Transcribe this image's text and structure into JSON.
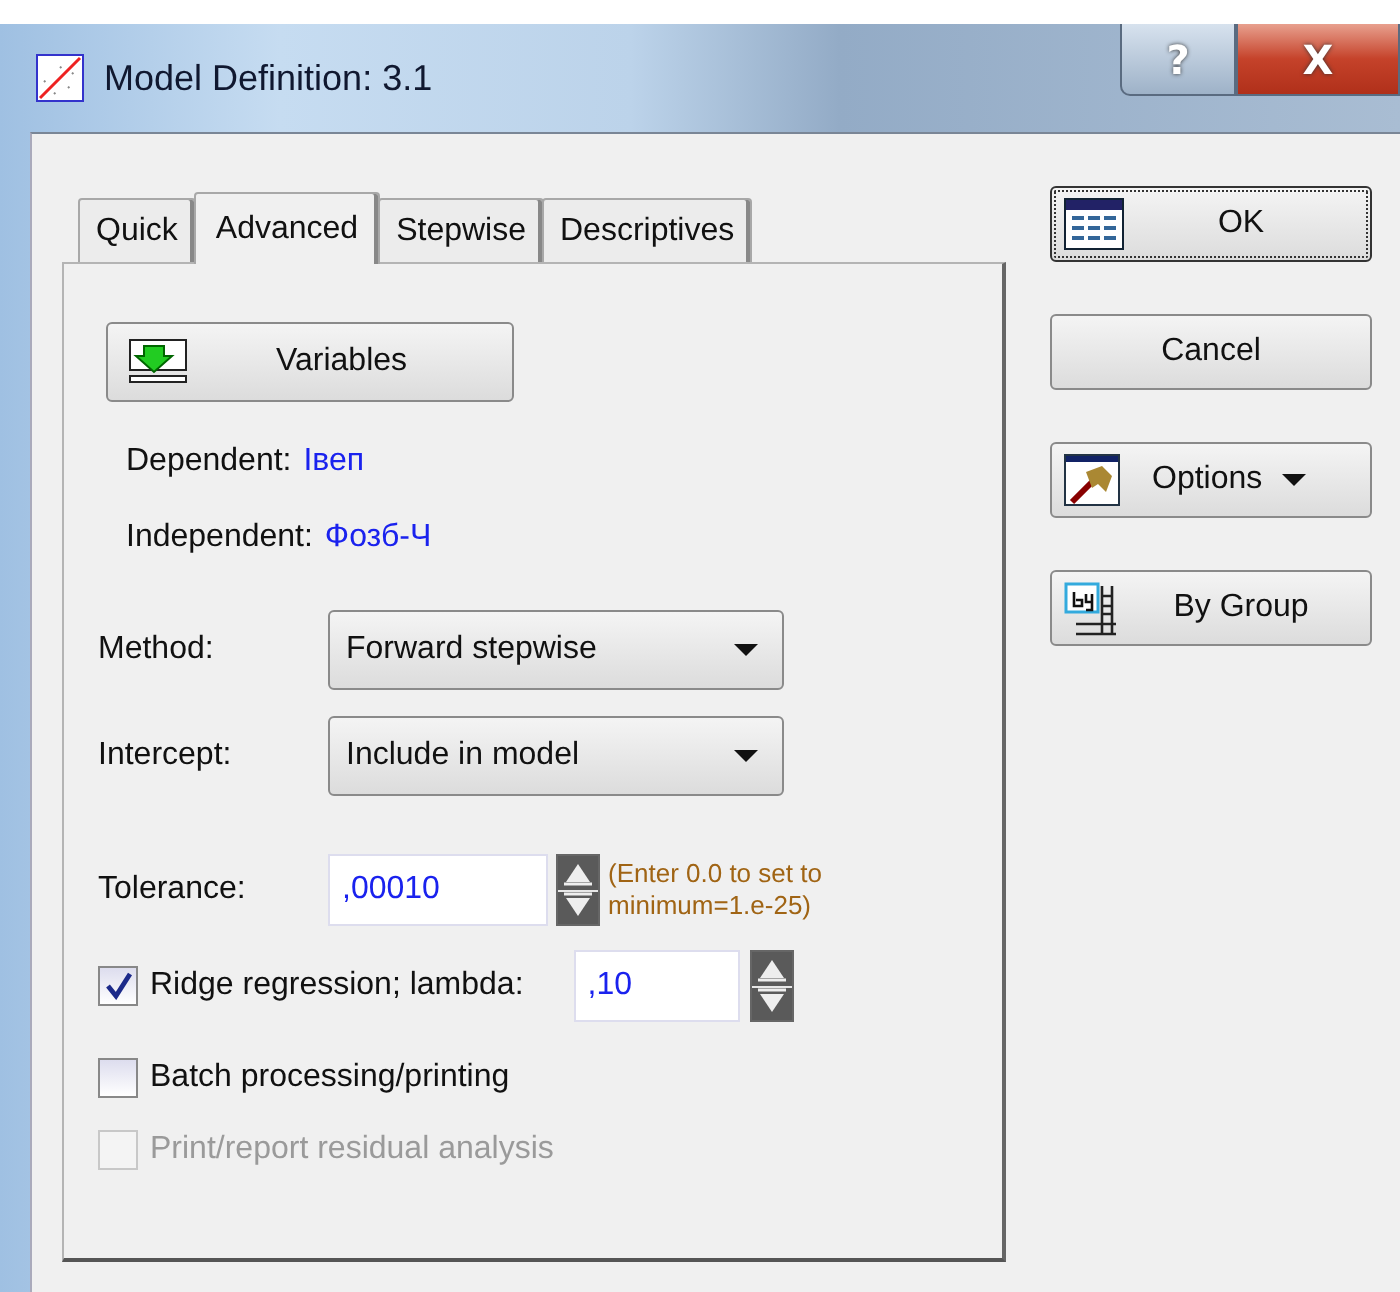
{
  "window": {
    "title": "Model Definition: 3.1",
    "help_label": "?",
    "close_label": "X"
  },
  "tabs": [
    {
      "label": "Quick",
      "selected": false
    },
    {
      "label": "Advanced",
      "selected": true
    },
    {
      "label": "Stepwise",
      "selected": false
    },
    {
      "label": "Descriptives",
      "selected": false
    }
  ],
  "variables_button": {
    "label": "Variables"
  },
  "variables": [
    {
      "label": "Dependent:",
      "value": "Івеп"
    },
    {
      "label": "Independent:",
      "value": "Фозб-Ч"
    }
  ],
  "dropdowns": [
    {
      "label": "Method:",
      "value": "Forward stepwise"
    },
    {
      "label": "Intercept:",
      "value": "Include in model"
    }
  ],
  "tolerance": {
    "label": "Tolerance:",
    "value": ",00010",
    "note": "(Enter 0.0 to set to minimum=1.e-25)"
  },
  "checks": [
    {
      "kind": "with-field",
      "label": "Ridge regression; lambda:",
      "checked": true,
      "disabled": false,
      "value": ",10"
    },
    {
      "kind": "plain",
      "label": "Batch processing/printing",
      "checked": false,
      "disabled": false
    },
    {
      "kind": "plain",
      "label": "Print/report residual analysis",
      "checked": false,
      "disabled": true
    }
  ],
  "side_buttons": [
    {
      "kind": "default",
      "label": "OK"
    },
    {
      "kind": "plain",
      "label": "Cancel"
    },
    {
      "kind": "menu",
      "label": "Options"
    },
    {
      "kind": "group",
      "label": "By Group"
    }
  ]
}
